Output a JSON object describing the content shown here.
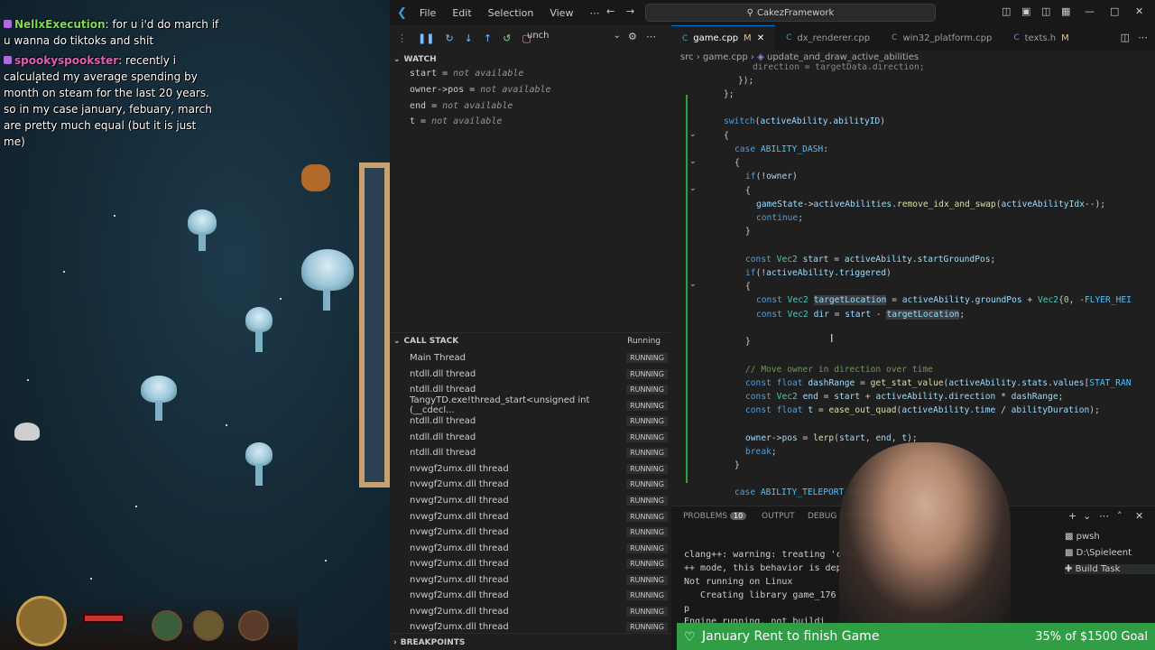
{
  "chat": [
    {
      "user": "NellxExecution",
      "text": ": for u i'd do march if u wanna do tiktoks and shit"
    },
    {
      "user": "spookyspookster",
      "text": ": recently i calculated my average spending by month on steam for the last 20 years. so in my case january, febuary, march are pretty much equal (but it is just me)"
    }
  ],
  "titlebar": {
    "menus": [
      "File",
      "Edit",
      "Selection",
      "View",
      "⋯"
    ],
    "command_center": "CakezFramework"
  },
  "debug": {
    "launch_label": "unch",
    "watch_header": "WATCH",
    "watch": [
      {
        "name": "start",
        "value": "not available"
      },
      {
        "name": "owner->pos",
        "value": "not available"
      },
      {
        "name": "end",
        "value": "not available"
      },
      {
        "name": "t",
        "value": "not available"
      }
    ],
    "callstack_header": "CALL STACK",
    "callstack_status": "Running",
    "threads": [
      "Main Thread",
      "ntdll.dll thread",
      "ntdll.dll thread",
      "TangyTD.exe!thread_start<unsigned int (__cdecl...",
      "ntdll.dll thread",
      "ntdll.dll thread",
      "ntdll.dll thread",
      "nvwgf2umx.dll thread",
      "nvwgf2umx.dll thread",
      "nvwgf2umx.dll thread",
      "nvwgf2umx.dll thread",
      "nvwgf2umx.dll thread",
      "nvwgf2umx.dll thread",
      "nvwgf2umx.dll thread",
      "nvwgf2umx.dll thread",
      "nvwgf2umx.dll thread",
      "nvwgf2umx.dll thread",
      "nvwgf2umx.dll thread"
    ],
    "thread_status": "RUNNING",
    "breakpoints_header": "BREAKPOINTS"
  },
  "tabs": [
    {
      "name": "game.cpp",
      "mark": "M",
      "active": true
    },
    {
      "name": "dx_renderer.cpp",
      "mark": "",
      "active": false
    },
    {
      "name": "win32_platform.cpp",
      "mark": "",
      "active": false
    },
    {
      "name": "texts.h",
      "mark": "M",
      "active": false
    }
  ],
  "breadcrumb": [
    "src",
    "game.cpp",
    "update_and_draw_active_abilities"
  ],
  "panel": {
    "tabs": [
      "PROBLEMS",
      "OUTPUT",
      "DEBUG CONSOLE"
    ],
    "problems_count": "10",
    "terminal": [
      "clang++: warning: treating 'c-he",
      "++ mode, this behavior is depr",
      "Not running on Linux",
      "   Creating library game_176",
      "p",
      "Engine running, not buildi"
    ],
    "sessions": [
      "pwsh",
      "D:\\Spieleent",
      "Build Task"
    ]
  },
  "goal": {
    "text": "January Rent to finish Game",
    "progress": "35% of $1500 Goal"
  }
}
